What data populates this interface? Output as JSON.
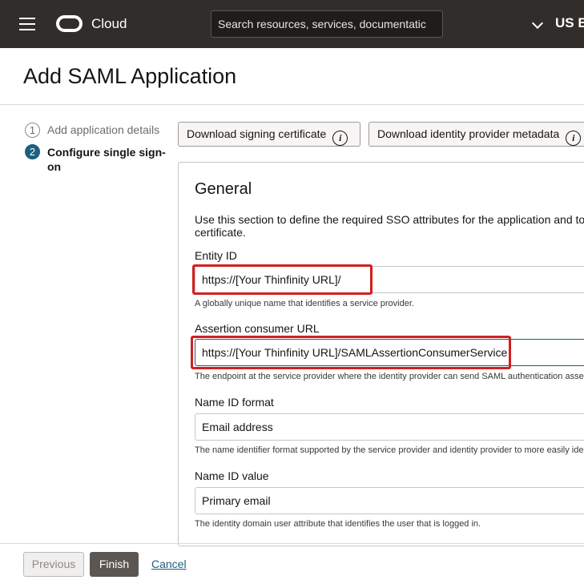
{
  "header": {
    "brand": "Cloud",
    "search_placeholder": "Search resources, services, documentatic",
    "region": "US Ea"
  },
  "page": {
    "title": "Add SAML Application"
  },
  "steps": [
    {
      "number": "1",
      "label": "Add application details",
      "state": "complete"
    },
    {
      "number": "2",
      "label": "Configure single sign-on",
      "state": "current"
    }
  ],
  "toolbar": {
    "download_cert_label": "Download signing certificate",
    "download_metadata_label": "Download identity provider metadata",
    "info_glyph": "i"
  },
  "general": {
    "title": "General",
    "description": "Use this section to define the required SSO attributes for the application and to certificate.",
    "fields": [
      {
        "label": "Entity ID",
        "value": "https://[Your Thinfinity URL]/",
        "help": "A globally unique name that identifies a service provider."
      },
      {
        "label": "Assertion consumer URL",
        "value": "https://[Your Thinfinity URL]/SAMLAssertionConsumerService",
        "help": "The endpoint at the service provider where the identity provider can send SAML authentication asse"
      },
      {
        "label": "Name ID format",
        "value": "Email address",
        "help": "The name identifier format supported by the service provider and identity provider to more easily ider"
      },
      {
        "label": "Name ID value",
        "value": "Primary email",
        "help": "The identity domain user attribute that identifies the user that is logged in."
      }
    ]
  },
  "footer": {
    "previous_label": "Previous",
    "finish_label": "Finish",
    "cancel_label": "Cancel"
  },
  "colors": {
    "topbar": "#312d2a",
    "accent": "#1c5f80",
    "highlight": "#d21f1f",
    "finish_button": "#5b5652"
  }
}
